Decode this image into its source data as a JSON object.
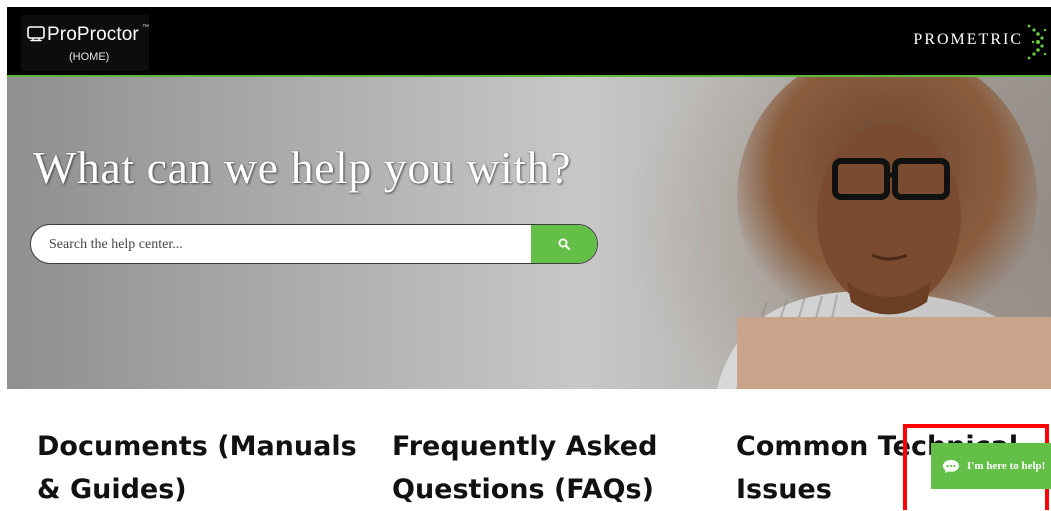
{
  "header": {
    "logo": {
      "name": "ProProctor",
      "trademark": "™",
      "sub": "(HOME)",
      "icon": "monitor-icon"
    },
    "brand": {
      "name": "PROMETRIC",
      "icon": "prometric-mark-icon"
    }
  },
  "hero": {
    "title": "What can we help you with?",
    "search": {
      "placeholder": "Search the help center...",
      "button_icon": "search-icon"
    }
  },
  "categories": [
    {
      "label": "Documents (Manuals & Guides)"
    },
    {
      "label": "Frequently Asked Questions (FAQs)"
    },
    {
      "label": "Common Technical Issues"
    }
  ],
  "chat": {
    "label": "I'm here to help!",
    "icon": "chat-bubble-icon"
  },
  "colors": {
    "accent": "#63bf47",
    "header": "#000000",
    "highlight": "#ff0000"
  }
}
